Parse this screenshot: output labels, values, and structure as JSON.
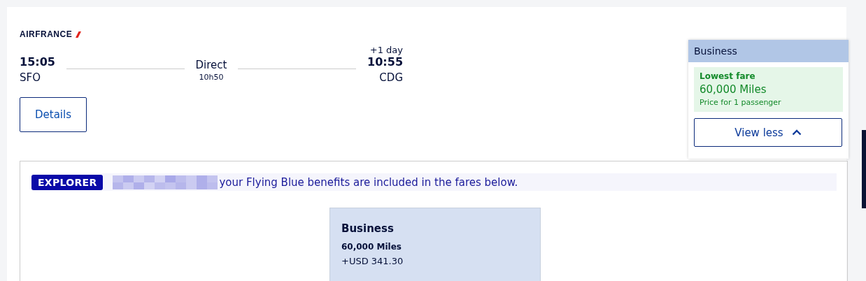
{
  "airline": {
    "name": "AIRFRANCE"
  },
  "flight": {
    "departure": {
      "time": "15:05",
      "airport": "SFO"
    },
    "stops": "Direct",
    "duration": "10h50",
    "arrival": {
      "day_offset": "+1 day",
      "time": "10:55",
      "airport": "CDG"
    }
  },
  "details_button": "Details",
  "popover": {
    "cabin": "Business",
    "badge": "Lowest fare",
    "price": "60,000 Miles",
    "note": "Price for 1 passenger",
    "toggle": "View less",
    "expanded": true
  },
  "banner": {
    "tier": "EXPLORER",
    "message": "your Flying Blue benefits are included in the fares below."
  },
  "fare_card": {
    "cabin": "Business",
    "miles": "60,000 Miles",
    "taxes": "+USD 341.30"
  }
}
